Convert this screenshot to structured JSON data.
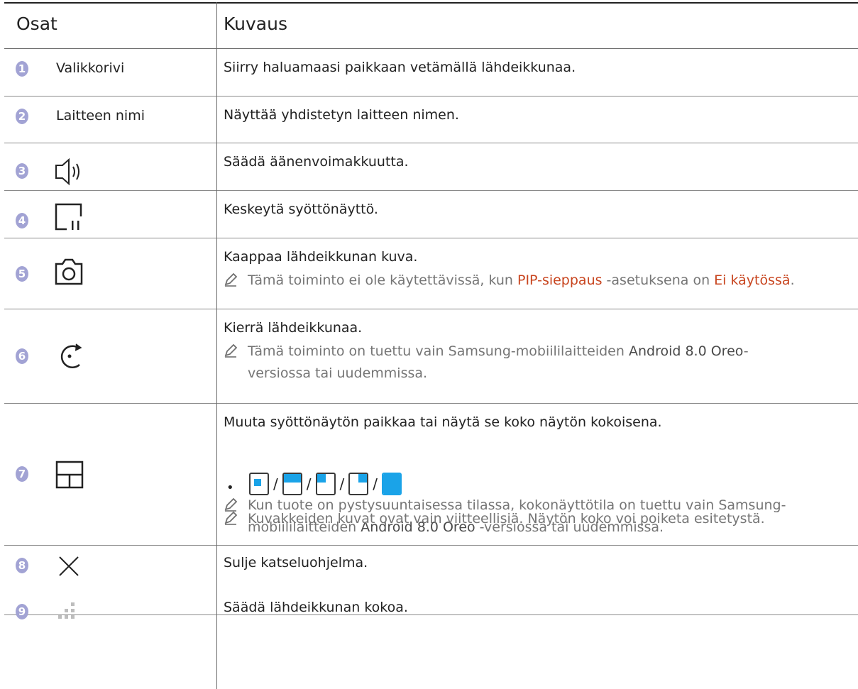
{
  "header": {
    "col1": "Osat",
    "col2": "Kuvaus"
  },
  "rows": [
    {
      "num": "1",
      "name": "Valikkorivi",
      "desc": "Siirry haluamaasi paikkaan vetämällä lähdeikkunaa."
    },
    {
      "num": "2",
      "name": "Laitteen nimi",
      "desc": "Näyttää yhdistetyn laitteen nimen."
    },
    {
      "num": "3",
      "icon": "speaker-volume-icon",
      "desc": "Säädä äänenvoimakkuutta."
    },
    {
      "num": "4",
      "icon": "pause-screen-icon",
      "desc": "Keskeytä syöttönäyttö."
    },
    {
      "num": "5",
      "icon": "camera-capture-icon",
      "desc": "Kaappaa lähdeikkunan kuva.",
      "note": {
        "pre": "Tämä toiminto ei ole käytettävissä, kun ",
        "hl1": "PIP-sieppaus",
        "mid": " -asetuksena on ",
        "hl2": "Ei käytössä",
        "post": "."
      }
    },
    {
      "num": "6",
      "icon": "rotate-icon",
      "desc": "Kierrä lähdeikkunaa.",
      "note": {
        "pre": "Tämä toiminto on tuettu vain Samsung-mobiililaitteiden ",
        "dk": "Android 8.0 Oreo",
        "post1": "-",
        "post2": "versiossa tai uudemmissa."
      }
    },
    {
      "num": "7",
      "icon": "layout-icon",
      "desc": "Muuta syöttönäytön paikkaa tai näytä se koko näytön kokoisena.",
      "bullet": "•",
      "sep": "/",
      "note1": {
        "line1": "Kun tuote on pystysuuntaisessa tilassa, kokonäyttötila on tuettu vain Samsung-",
        "line2pre": "mobiililaitteiden ",
        "dk": "Android 8.0 Oreo",
        "line2post": " -versiossa tai uudemmissa."
      },
      "note2": "Kuvakkeiden kuvat ovat vain viitteellisiä. Näytön koko voi poiketa esitetystä."
    },
    {
      "num": "8",
      "icon": "close-icon",
      "desc": "Sulje katseluohjelma."
    },
    {
      "num": "9",
      "icon": "resize-handle-icon",
      "desc": "Säädä lähdeikkunan kokoa."
    }
  ]
}
